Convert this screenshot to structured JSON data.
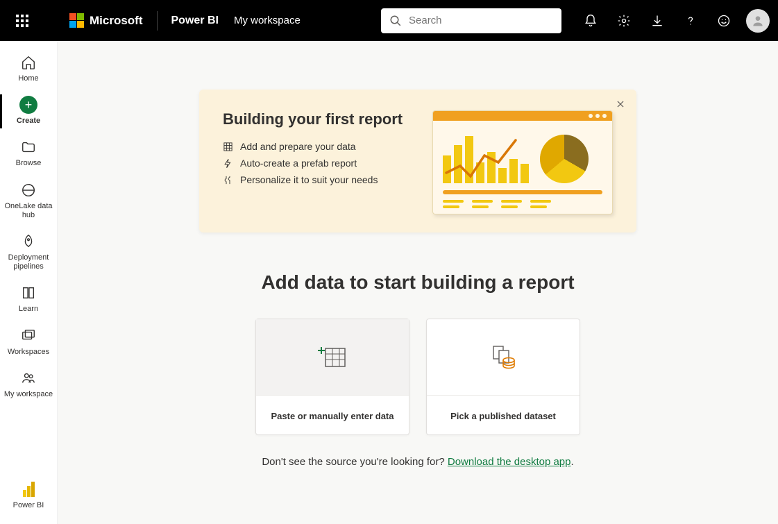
{
  "header": {
    "brand": "Microsoft",
    "product": "Power BI",
    "workspace": "My workspace",
    "search_placeholder": "Search"
  },
  "nav": {
    "home": "Home",
    "create": "Create",
    "browse": "Browse",
    "onelake": "OneLake data hub",
    "deployment": "Deployment pipelines",
    "learn": "Learn",
    "workspaces": "Workspaces",
    "myworkspace": "My workspace",
    "powerbi": "Power BI"
  },
  "banner": {
    "title": "Building your first report",
    "step1": "Add and prepare your data",
    "step2": "Auto-create a prefab report",
    "step3": "Personalize it to suit your needs"
  },
  "main": {
    "heading": "Add data to start building a report",
    "card1": "Paste or manually enter data",
    "card2": "Pick a published dataset",
    "footer_pre": "Don't see the source you're looking for? ",
    "footer_link": "Download the desktop app",
    "footer_post": "."
  }
}
